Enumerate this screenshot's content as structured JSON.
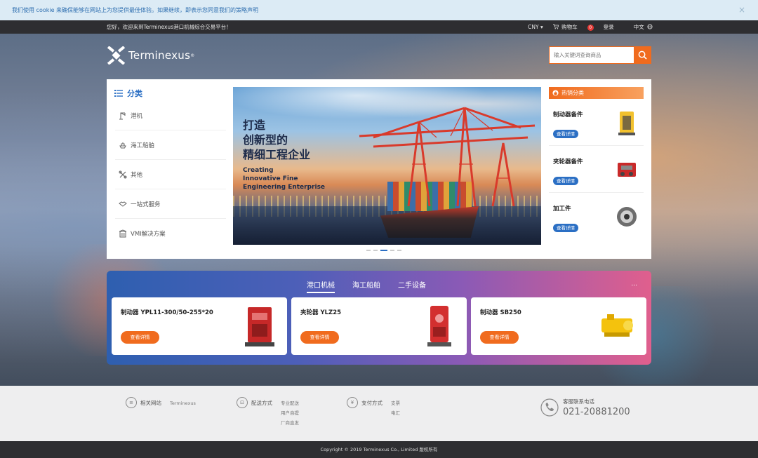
{
  "cookie": {
    "text": "我们使用 cookie 来确保能够在网站上为您提供最佳体验。如果继续，即表示您同意我们的策略声明",
    "close_label": "×"
  },
  "topbar": {
    "welcome": "您好，欢迎来到Terminexus港口机械综合交易平台！",
    "currency": "CNY ▾",
    "cart_label": "购物车",
    "cart_count": "0",
    "login": "登录",
    "language": "中文"
  },
  "logo": {
    "text": "Terminexus",
    "mark": "®"
  },
  "search": {
    "placeholder": "输入关键词查询商品"
  },
  "categories": {
    "title": "分类",
    "items": [
      {
        "label": "港机",
        "icon": "crane-icon"
      },
      {
        "label": "海工船舶",
        "icon": "ship-icon"
      },
      {
        "label": "其他",
        "icon": "tools-icon"
      },
      {
        "label": "一站式服务",
        "icon": "handshake-icon"
      },
      {
        "label": "VMI解决方案",
        "icon": "building-icon"
      }
    ]
  },
  "banner": {
    "line1": "打造",
    "line2": "创新型的",
    "line3": "精细工程企业",
    "en1": "Creating",
    "en2": "Innovative Fine",
    "en3": "Engineering Enterprise"
  },
  "hot": {
    "title": "热销分类",
    "items": [
      {
        "name": "制动器备件",
        "button": "查看详情"
      },
      {
        "name": "夹轮器备件",
        "button": "查看详情"
      },
      {
        "name": "加工件",
        "button": "查看详情"
      }
    ]
  },
  "products": {
    "tabs": [
      "港口机械",
      "海工船舶",
      "二手设备"
    ],
    "more": "...",
    "cards": [
      {
        "name": "制动器 YPL11-300/50-255*20",
        "button": "查看详情"
      },
      {
        "name": "夹轮器 YLZ25",
        "button": "查看详情"
      },
      {
        "name": "制动器 SB250",
        "button": "查看详情"
      }
    ]
  },
  "footer": {
    "cols": [
      {
        "title": "相关网站",
        "links": [
          "Terminexus"
        ]
      },
      {
        "title": "配送方式",
        "links": [
          "专业配送",
          "用户自提",
          "厂商直发"
        ]
      },
      {
        "title": "支付方式",
        "links": [
          "支票",
          "电汇"
        ]
      }
    ],
    "phone_title": "客服联系电话",
    "phone": "021-20881200",
    "copyright": "Copyright © 2019 Terminexus Co., Limited 版权所有"
  },
  "colors": {
    "accent": "#f06b1e",
    "brand_blue": "#2b6fc4",
    "topbar": "#2e2e31"
  }
}
